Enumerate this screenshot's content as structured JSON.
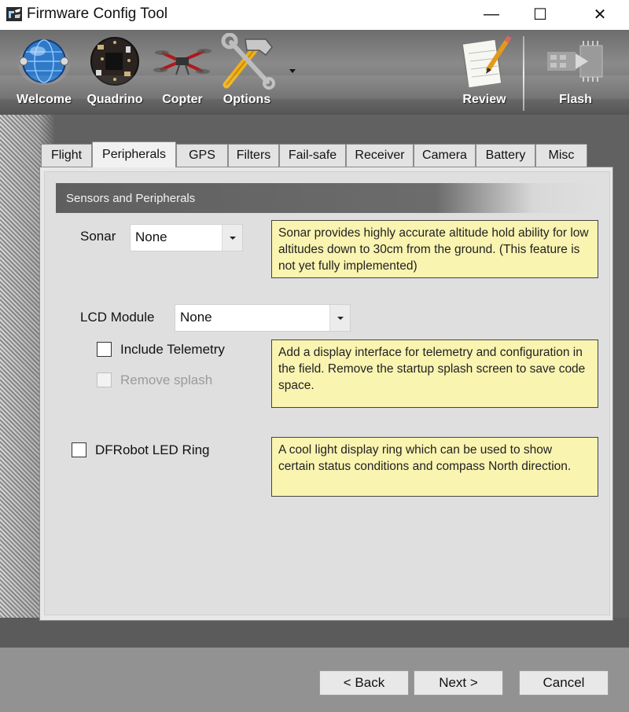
{
  "window": {
    "title": "Firmware Config Tool",
    "minimize_glyph": "—",
    "maximize_glyph": "☐",
    "close_glyph": "✕"
  },
  "toolbar": {
    "items": [
      {
        "label": "Welcome",
        "icon": "globe-icon"
      },
      {
        "label": "Quadrino",
        "icon": "circuit-board-icon"
      },
      {
        "label": "Copter",
        "icon": "quadcopter-icon"
      },
      {
        "label": "Options",
        "icon": "tools-icon"
      },
      {
        "label": "Review",
        "icon": "notepad-icon"
      },
      {
        "label": "Flash",
        "icon": "chip-flash-icon"
      }
    ]
  },
  "tabs": [
    {
      "label": "Flight"
    },
    {
      "label": "Peripherals",
      "active": true
    },
    {
      "label": "GPS"
    },
    {
      "label": "Filters"
    },
    {
      "label": "Fail-safe"
    },
    {
      "label": "Receiver"
    },
    {
      "label": "Camera"
    },
    {
      "label": "Battery"
    },
    {
      "label": "Misc"
    }
  ],
  "section": {
    "title": "Sensors and Peripherals"
  },
  "sonar": {
    "label": "Sonar",
    "value": "None",
    "note": "Sonar provides highly accurate altitude hold ability for low altitudes down to 30cm from the ground. (This feature is not yet fully implemented)"
  },
  "lcd": {
    "label": "LCD Module",
    "value": "None",
    "include_telemetry_label": "Include Telemetry",
    "include_telemetry_checked": false,
    "remove_splash_label": "Remove splash",
    "remove_splash_checked": false,
    "remove_splash_enabled": false,
    "note": "Add a display interface for telemetry and configuration in the field. Remove the startup splash screen to save code space."
  },
  "led_ring": {
    "label": "DFRobot LED Ring",
    "checked": false,
    "note": "A cool light display ring which can be used to show certain status conditions and compass North direction."
  },
  "footer": {
    "back_label": "< Back",
    "next_label": "Next >",
    "cancel_label": "Cancel"
  }
}
